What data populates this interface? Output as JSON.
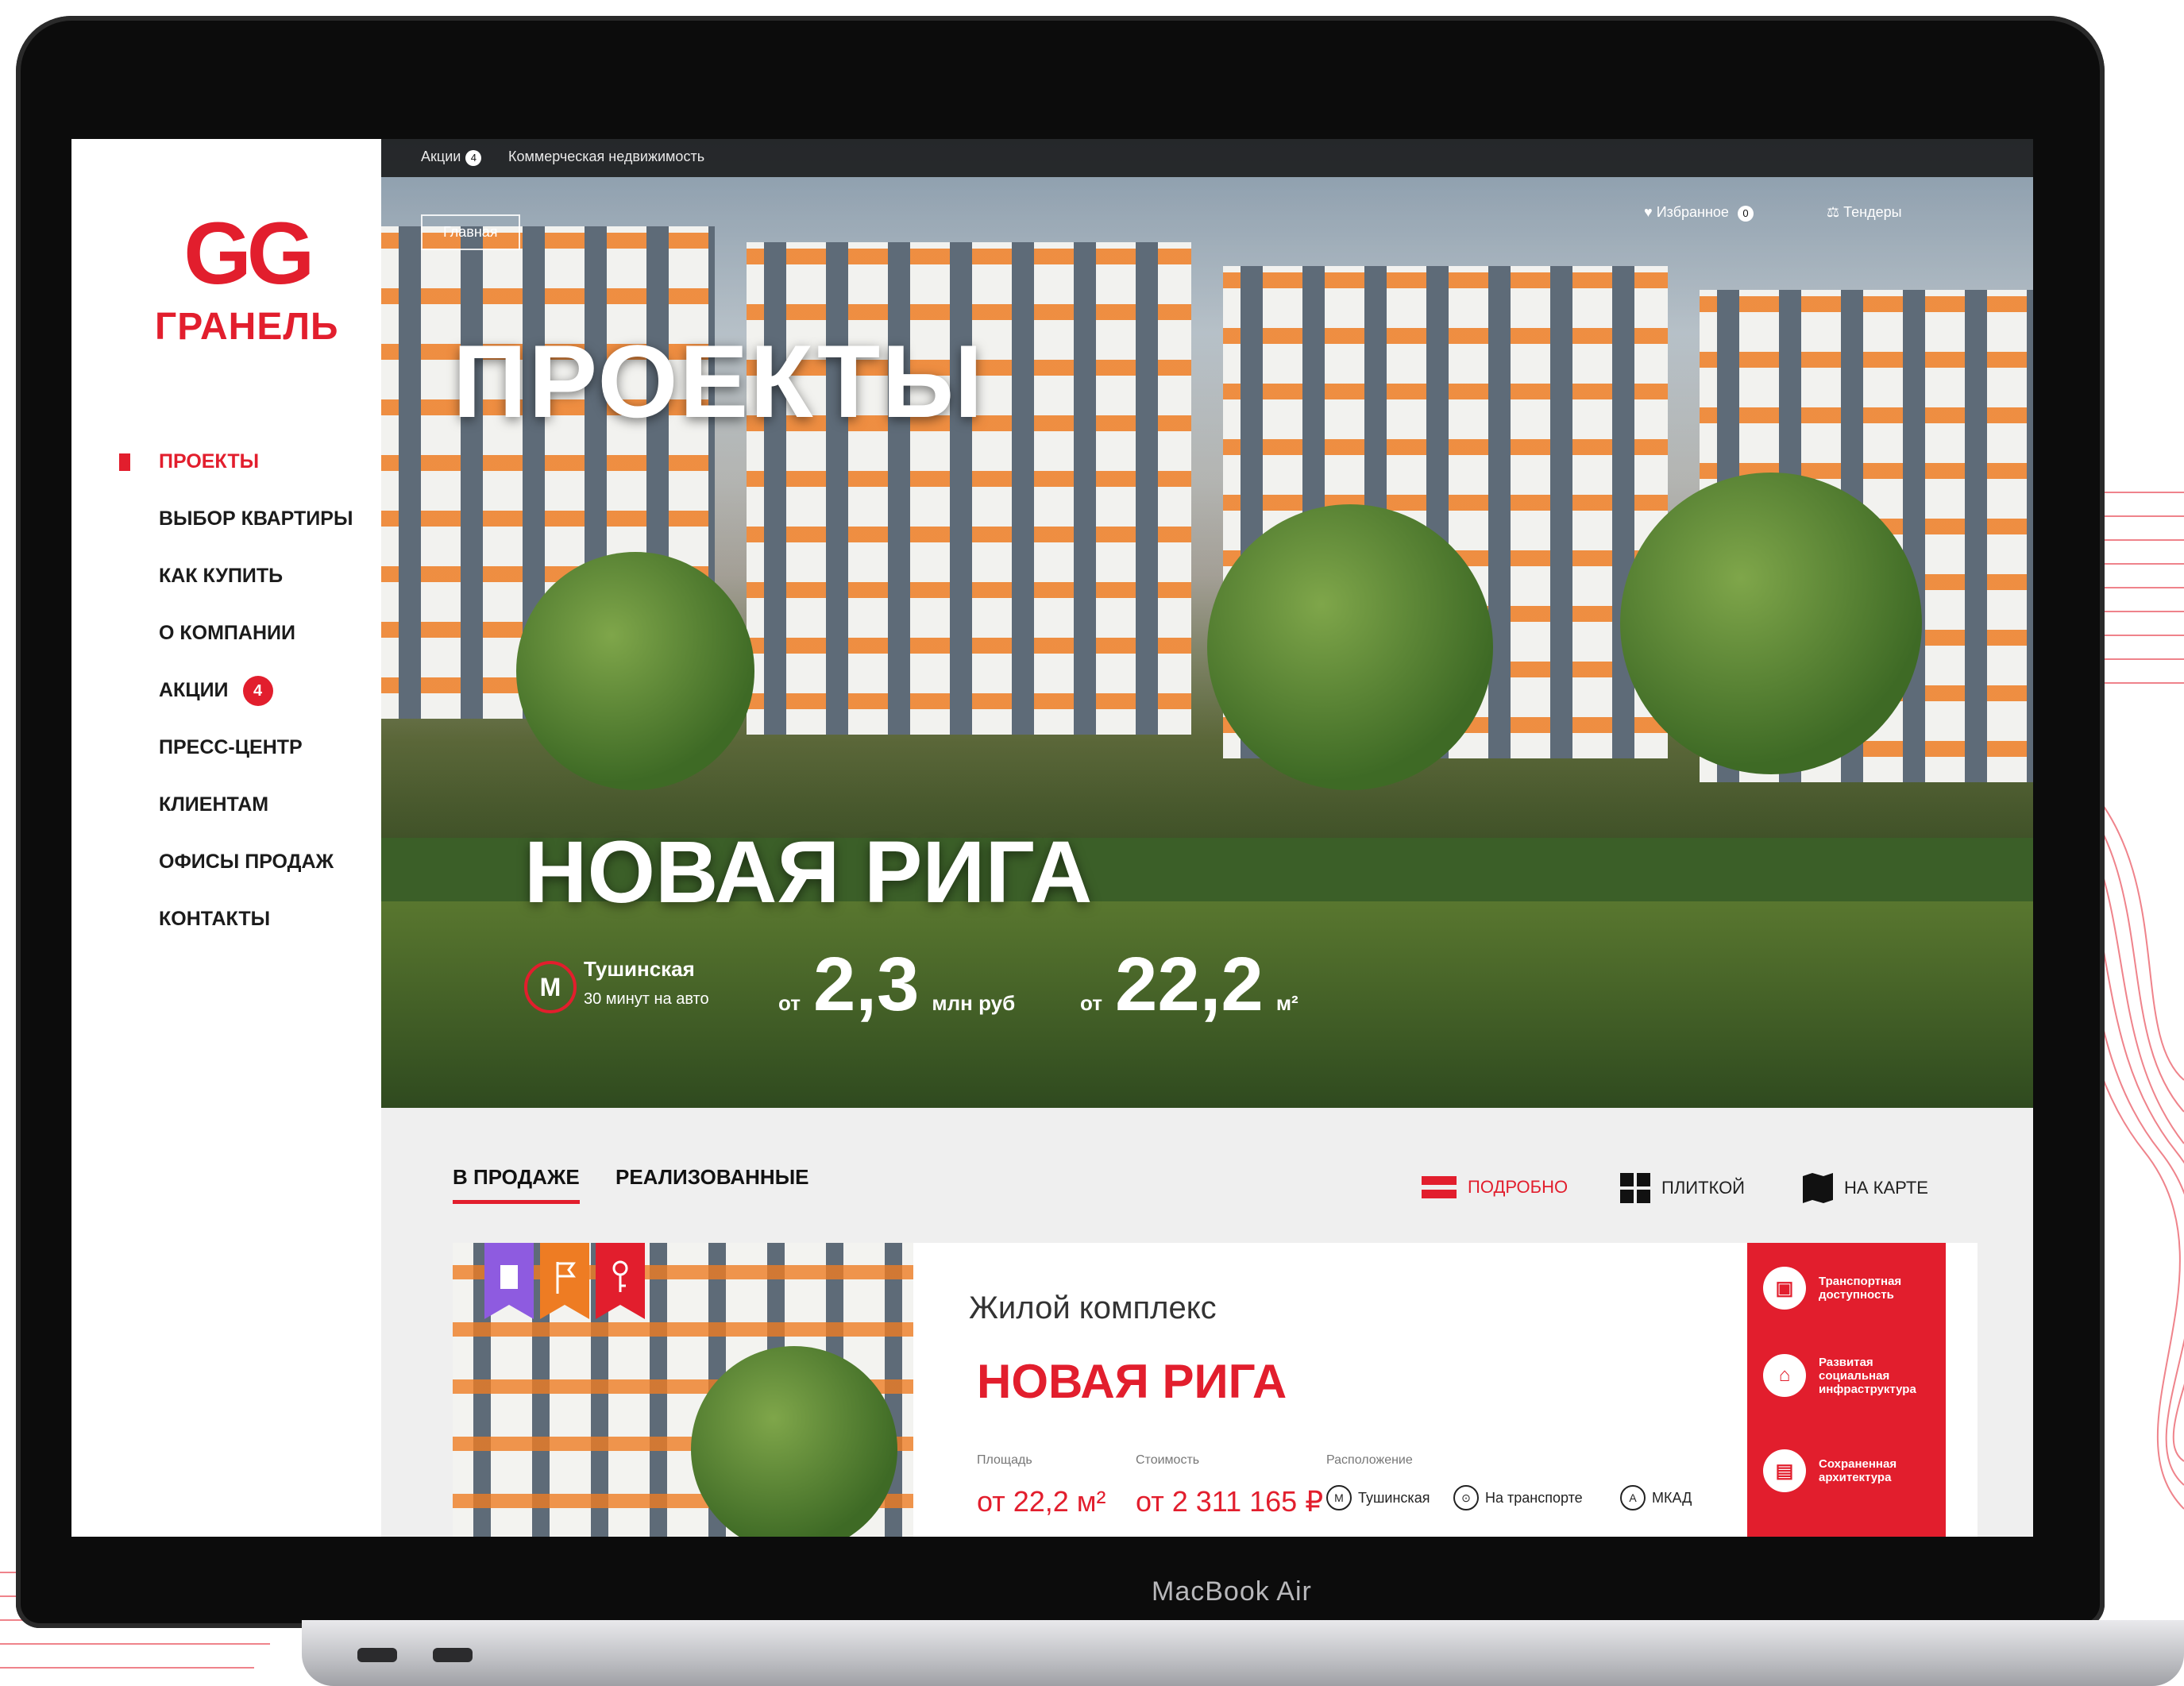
{
  "brand": {
    "mark": "GG",
    "name": "ГРАНЕЛЬ",
    "accent": "#e21e2d"
  },
  "nav": [
    {
      "label": "ПРОЕКТЫ",
      "active": true
    },
    {
      "label": "ВЫБОР КВАРТИРЫ"
    },
    {
      "label": "КАК КУПИТЬ"
    },
    {
      "label": "О КОМПАНИИ"
    },
    {
      "label": "АКЦИИ",
      "badge": "4"
    },
    {
      "label": "ПРЕСС-ЦЕНТР"
    },
    {
      "label": "КЛИЕНТАМ"
    },
    {
      "label": "ОФИСЫ ПРОДАЖ"
    },
    {
      "label": "КОНТАКТЫ"
    }
  ],
  "topbar": {
    "promo": "Акции",
    "promo_badge": "4",
    "commercial": "Коммерческая недвижимость"
  },
  "header": {
    "breadcrumb": "Главная",
    "favorites": "Избранное",
    "favorites_count": "0",
    "tenders": "Тендеры"
  },
  "hero": {
    "heading": "ПРОЕКТЫ",
    "project": "НОВАЯ РИГА",
    "metro_icon": "М",
    "metro_station": "Тушинская",
    "metro_time": "30 минут на авто",
    "price_prefix": "от",
    "price_value": "2,3",
    "price_unit": "млн руб",
    "area_prefix": "от",
    "area_value": "22,2",
    "area_unit": "м²"
  },
  "tabs": [
    {
      "label": "В ПРОДАЖЕ",
      "active": true
    },
    {
      "label": "РЕАЛИЗОВАННЫЕ"
    }
  ],
  "views": [
    {
      "label": "ПОДРОБНО",
      "active": true
    },
    {
      "label": "ПЛИТКОЙ"
    },
    {
      "label": "НА КАРТЕ"
    }
  ],
  "card": {
    "subtitle": "Жилой комплекс",
    "title": "НОВАЯ РИГА",
    "area_label": "Площадь",
    "area_value": "от 22,2 м²",
    "price_label": "Стоимость",
    "price_value": "от 2 311 165 ₽",
    "location_label": "Расположение",
    "locations": [
      {
        "icon": "М",
        "label": "Тушинская"
      },
      {
        "icon": "⊙",
        "label": "На транспорте"
      },
      {
        "icon": "А",
        "label": "МКАД"
      }
    ],
    "ribbon_colors": [
      "#8e5be0",
      "#ee7c23",
      "#e21e2d"
    ],
    "features": [
      "Транспортная доступность",
      "Развитая социальная инфраструктура",
      "Сохраненная архитектура"
    ]
  },
  "device_label": "MacBook Air"
}
